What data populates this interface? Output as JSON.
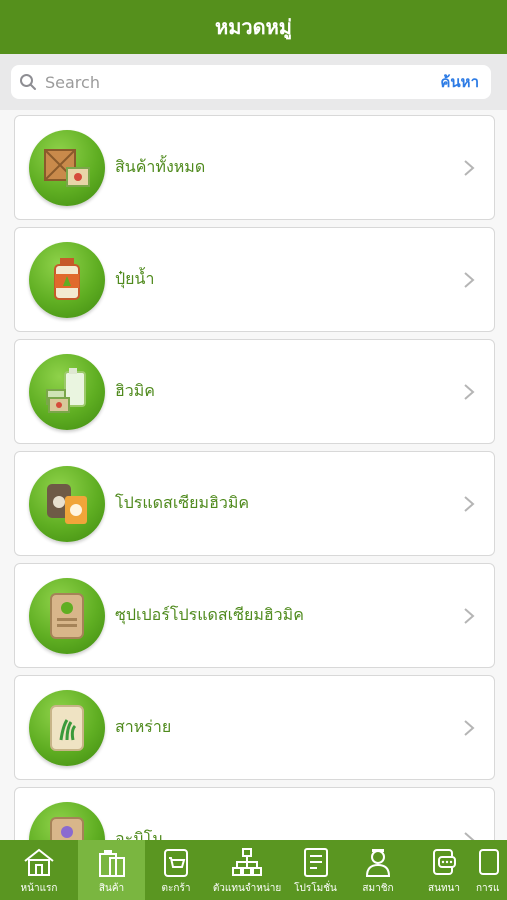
{
  "header": {
    "title": "หมวดหมู่"
  },
  "search": {
    "placeholder": "Search",
    "button_label": "ค้นหา"
  },
  "categories": [
    {
      "label": "สินค้าทั้งหมด",
      "icon": "all-products-icon"
    },
    {
      "label": "ปุ๋ยน้ำ",
      "icon": "liquid-fertilizer-bottle-icon"
    },
    {
      "label": "ฮิวมิค",
      "icon": "humic-gallon-icon"
    },
    {
      "label": "โปรแดสเซียมฮิวมิค",
      "icon": "potassium-humic-sacks-icon"
    },
    {
      "label": "ซุปเปอร์โปรแดสเซียมฮิวมิค",
      "icon": "super-potassium-sack-icon"
    },
    {
      "label": "สาหร่าย",
      "icon": "seaweed-sack-icon"
    },
    {
      "label": "อะมิโน",
      "icon": "amino-sack-icon"
    }
  ],
  "tabs": [
    {
      "label": "หน้าแรก",
      "icon": "home-icon",
      "active": false
    },
    {
      "label": "สินค้า",
      "icon": "product-icon",
      "active": true
    },
    {
      "label": "ตะกร้า",
      "icon": "cart-icon",
      "active": false
    },
    {
      "label": "ตัวแทนจำหน่าย",
      "icon": "dealer-network-icon",
      "active": false
    },
    {
      "label": "โปรโมชั่น",
      "icon": "promotion-icon",
      "active": false
    },
    {
      "label": "สมาชิก",
      "icon": "member-icon",
      "active": false
    },
    {
      "label": "สนทนา",
      "icon": "chat-icon",
      "active": false
    },
    {
      "label": "การแ",
      "icon": "settings-icon",
      "active": false
    }
  ],
  "colors": {
    "header": "#55901c",
    "tabbar": "#5a9621",
    "tab_active": "#7ab640",
    "label": "#4f8a1d",
    "link": "#2e7ce5"
  }
}
